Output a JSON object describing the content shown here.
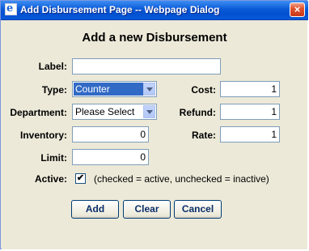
{
  "window": {
    "title": "Add Disbursement Page -- Webpage Dialog",
    "close_label": "×"
  },
  "form": {
    "heading": "Add a new Disbursement",
    "label": {
      "label": "Label:",
      "value": ""
    },
    "type": {
      "label": "Type:",
      "value": "Counter"
    },
    "department": {
      "label": "Department:",
      "value": "Please Select"
    },
    "inventory": {
      "label": "Inventory:",
      "value": "0"
    },
    "limit": {
      "label": "Limit:",
      "value": "0"
    },
    "cost": {
      "label": "Cost:",
      "value": "1"
    },
    "refund": {
      "label": "Refund:",
      "value": "1"
    },
    "rate": {
      "label": "Rate:",
      "value": "1"
    },
    "active": {
      "label": "Active:",
      "checked": true,
      "check_glyph": "✔",
      "note": "(checked = active, unchecked = inactive)"
    }
  },
  "buttons": {
    "add": "Add",
    "clear": "Clear",
    "cancel": "Cancel"
  },
  "icons": {
    "title": "ie-page-icon",
    "close": "close-icon",
    "dropdown": "chevron-down-icon"
  }
}
